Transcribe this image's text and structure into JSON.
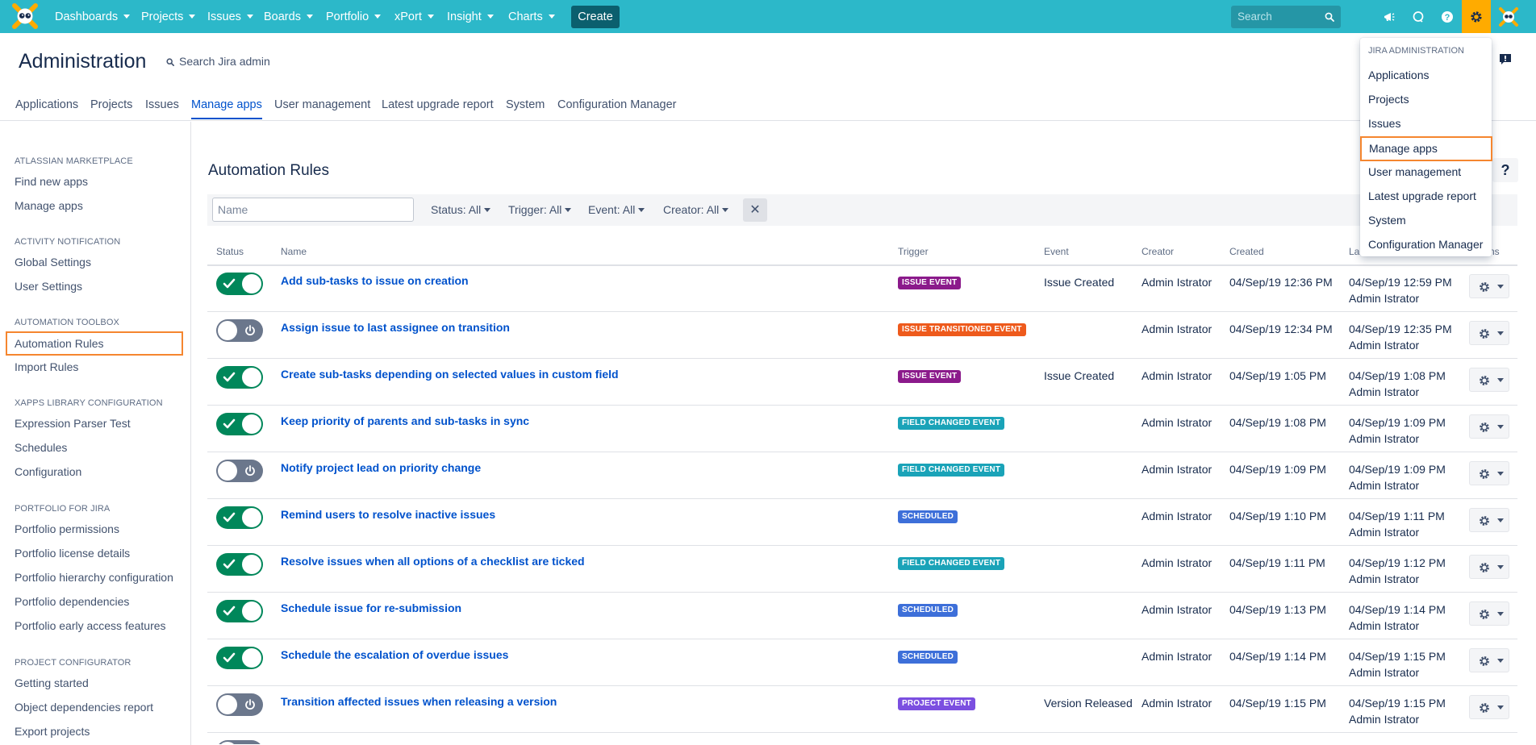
{
  "nav": {
    "items": [
      {
        "label": "Dashboards"
      },
      {
        "label": "Projects"
      },
      {
        "label": "Issues"
      },
      {
        "label": "Boards"
      },
      {
        "label": "Portfolio"
      },
      {
        "label": "xPort"
      },
      {
        "label": "Insight"
      },
      {
        "label": "Charts"
      }
    ],
    "create_label": "Create",
    "search_placeholder": "Search",
    "icons": [
      "logo-icon",
      "notifications-icon",
      "feedback-icon",
      "help-icon",
      "gear-icon",
      "avatar-icon"
    ],
    "accent_color": "#2cb8c9",
    "active_icon_color": "#ffab00"
  },
  "header": {
    "title": "Administration",
    "search_label": "Search Jira admin"
  },
  "tabs": [
    {
      "label": "Applications"
    },
    {
      "label": "Projects"
    },
    {
      "label": "Issues"
    },
    {
      "label": "Manage apps",
      "active": true
    },
    {
      "label": "User management"
    },
    {
      "label": "Latest upgrade report"
    },
    {
      "label": "System"
    },
    {
      "label": "Configuration Manager"
    }
  ],
  "sidebar": {
    "sections": [
      {
        "heading": "Atlassian Marketplace",
        "items": [
          "Find new apps",
          "Manage apps"
        ]
      },
      {
        "heading": "Activity Notification",
        "items": [
          "Global Settings",
          "User Settings"
        ]
      },
      {
        "heading": "Automation Toolbox",
        "items": [
          "Automation Rules",
          "Import Rules"
        ]
      },
      {
        "heading": "xApps Library Configuration",
        "items": [
          "Expression Parser Test",
          "Schedules",
          "Configuration"
        ]
      },
      {
        "heading": "Portfolio for Jira",
        "items": [
          "Portfolio permissions",
          "Portfolio license details",
          "Portfolio hierarchy configuration",
          "Portfolio dependencies",
          "Portfolio early access features"
        ]
      },
      {
        "heading": "Project Configurator",
        "items": [
          "Getting started",
          "Object dependencies report",
          "Export projects"
        ]
      }
    ],
    "highlighted": "Automation Rules"
  },
  "main": {
    "title": "Automation Rules",
    "filters": {
      "name_placeholder": "Name",
      "status": "Status: All",
      "trigger": "Trigger: All",
      "event": "Event: All",
      "creator": "Creator: All",
      "clear": "✕"
    },
    "columns": {
      "status": "Status",
      "name": "Name",
      "trigger": "Trigger",
      "event": "Event",
      "creator": "Creator",
      "created": "Created",
      "last_modified": "La",
      "actions": "ns"
    },
    "rows": [
      {
        "enabled": true,
        "name": "Add sub-tasks to issue on creation",
        "trigger": "ISSUE EVENT",
        "trigger_color": "#8b1a8b",
        "event": "Issue Created",
        "creator": "Admin Istrator",
        "created": "04/Sep/19 12:36 PM",
        "modified": "04/Sep/19 12:59 PM",
        "modified_by": "Admin Istrator"
      },
      {
        "enabled": false,
        "name": "Assign issue to last assignee on transition",
        "trigger": "ISSUE TRANSITIONED EVENT",
        "trigger_color": "#ee5a1c",
        "event": "",
        "creator": "Admin Istrator",
        "created": "04/Sep/19 12:34 PM",
        "modified": "04/Sep/19 12:35 PM",
        "modified_by": "Admin Istrator"
      },
      {
        "enabled": true,
        "name": "Create sub-tasks depending on selected values in custom field",
        "trigger": "ISSUE EVENT",
        "trigger_color": "#8b1a8b",
        "event": "Issue Created",
        "creator": "Admin Istrator",
        "created": "04/Sep/19 1:05 PM",
        "modified": "04/Sep/19 1:08 PM",
        "modified_by": "Admin Istrator"
      },
      {
        "enabled": true,
        "name": "Keep priority of parents and sub-tasks in sync",
        "trigger": "FIELD CHANGED EVENT",
        "trigger_color": "#1aa3b8",
        "event": "",
        "creator": "Admin Istrator",
        "created": "04/Sep/19 1:08 PM",
        "modified": "04/Sep/19 1:09 PM",
        "modified_by": "Admin Istrator"
      },
      {
        "enabled": false,
        "name": "Notify project lead on priority change",
        "trigger": "FIELD CHANGED EVENT",
        "trigger_color": "#1aa3b8",
        "event": "",
        "creator": "Admin Istrator",
        "created": "04/Sep/19 1:09 PM",
        "modified": "04/Sep/19 1:09 PM",
        "modified_by": "Admin Istrator"
      },
      {
        "enabled": true,
        "name": "Remind users to resolve inactive issues",
        "trigger": "SCHEDULED",
        "trigger_color": "#3d6fd9",
        "event": "",
        "creator": "Admin Istrator",
        "created": "04/Sep/19 1:10 PM",
        "modified": "04/Sep/19 1:11 PM",
        "modified_by": "Admin Istrator"
      },
      {
        "enabled": true,
        "name": "Resolve issues when all options of a checklist are ticked",
        "trigger": "FIELD CHANGED EVENT",
        "trigger_color": "#1aa3b8",
        "event": "",
        "creator": "Admin Istrator",
        "created": "04/Sep/19 1:11 PM",
        "modified": "04/Sep/19 1:12 PM",
        "modified_by": "Admin Istrator"
      },
      {
        "enabled": true,
        "name": "Schedule issue for re-submission",
        "trigger": "SCHEDULED",
        "trigger_color": "#3d6fd9",
        "event": "",
        "creator": "Admin Istrator",
        "created": "04/Sep/19 1:13 PM",
        "modified": "04/Sep/19 1:14 PM",
        "modified_by": "Admin Istrator"
      },
      {
        "enabled": true,
        "name": "Schedule the escalation of overdue issues",
        "trigger": "SCHEDULED",
        "trigger_color": "#3d6fd9",
        "event": "",
        "creator": "Admin Istrator",
        "created": "04/Sep/19 1:14 PM",
        "modified": "04/Sep/19 1:15 PM",
        "modified_by": "Admin Istrator"
      },
      {
        "enabled": false,
        "name": "Transition affected issues when releasing a version",
        "trigger": "PROJECT EVENT",
        "trigger_color": "#7b4fe0",
        "event": "Version Released",
        "creator": "Admin Istrator",
        "created": "04/Sep/19 1:15 PM",
        "modified": "04/Sep/19 1:15 PM",
        "modified_by": "Admin Istrator"
      }
    ]
  },
  "admin_menu": {
    "heading": "Jira Administration",
    "items": [
      "Applications",
      "Projects",
      "Issues",
      "Manage apps",
      "User management",
      "Latest upgrade report",
      "System",
      "Configuration Manager"
    ],
    "highlighted": "Manage apps"
  }
}
